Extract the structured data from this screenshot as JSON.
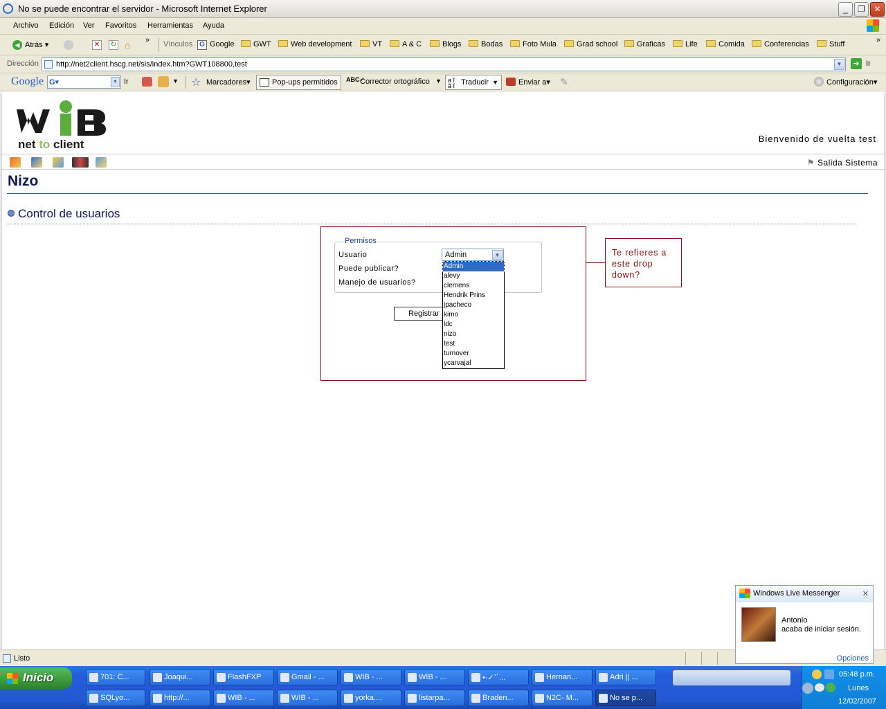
{
  "window": {
    "title": "No se puede encontrar el servidor - Microsoft Internet Explorer"
  },
  "menu": [
    "Archivo",
    "Edición",
    "Ver",
    "Favoritos",
    "Herramientas",
    "Ayuda"
  ],
  "toolbar": {
    "back": "Atrás",
    "links_label": "Vínculos",
    "overflow": "»"
  },
  "links": [
    "Google",
    "GWT",
    "Web development",
    "VT",
    "A & C",
    "Blogs",
    "Bodas",
    "Foto Mula",
    "Grad school",
    "Graficas",
    "Life",
    "Comida",
    "Conferencias",
    "Stuff"
  ],
  "address": {
    "label": "Dirección",
    "url": "http://net2client.hscg.net/sis/index.htm?GWT108800,test",
    "go": "Ir"
  },
  "googlebar": {
    "brand": "Google",
    "search_letter": "G▾",
    "go": "Ir",
    "bookmarks": "Marcadores▾",
    "popups": "Pop-ups permitidos",
    "spell": "Corrector ortográfico",
    "translate": "Traducir",
    "send": "Enviar a▾",
    "settings": "Configuración▾"
  },
  "page": {
    "logo_text": "net to client",
    "welcome": "Bienvenido de vuelta test",
    "exit": "Salida Sistema",
    "title": "Nizo",
    "section": "Control de usuarios",
    "form": {
      "legend": "Permisos",
      "user_label": "Usuario",
      "publish_label": "Puede publicar?",
      "manage_label": "Manejo de usuarios?",
      "selected_user": "Admin",
      "options": [
        "Admin",
        "alevy",
        "clemens",
        "Hendrik Prins",
        "jpacheco",
        "kimo",
        "ldc",
        "nizo",
        "test",
        "turnover",
        "ycarvajal"
      ],
      "submit": "Registrar"
    },
    "callout": "Te refieres a este drop down?"
  },
  "messenger": {
    "title": "Windows Live Messenger",
    "close": "✕",
    "contact": "Antonio",
    "message": "acaba de iniciar sesión.",
    "options": "Opciones"
  },
  "status": {
    "text": "Listo"
  },
  "taskbar": {
    "start": "Inicio",
    "row1": [
      "701: C...",
      "Joaqui...",
      "FlashFXP",
      "Gmail - ...",
      "WIB - ...",
      "WIB - ...",
      "•·✓ˇ˙...",
      "Hernan...",
      "Adri || ..."
    ],
    "row2": [
      "SQLyo...",
      "http://...",
      "WIB - ...",
      "WIB - ...",
      "yorka....",
      "listarpa...",
      "Braden...",
      "N2C- M...",
      "No se p..."
    ],
    "time": "05:48 p.m.",
    "day": "Lunes",
    "date": "12/02/2007"
  }
}
